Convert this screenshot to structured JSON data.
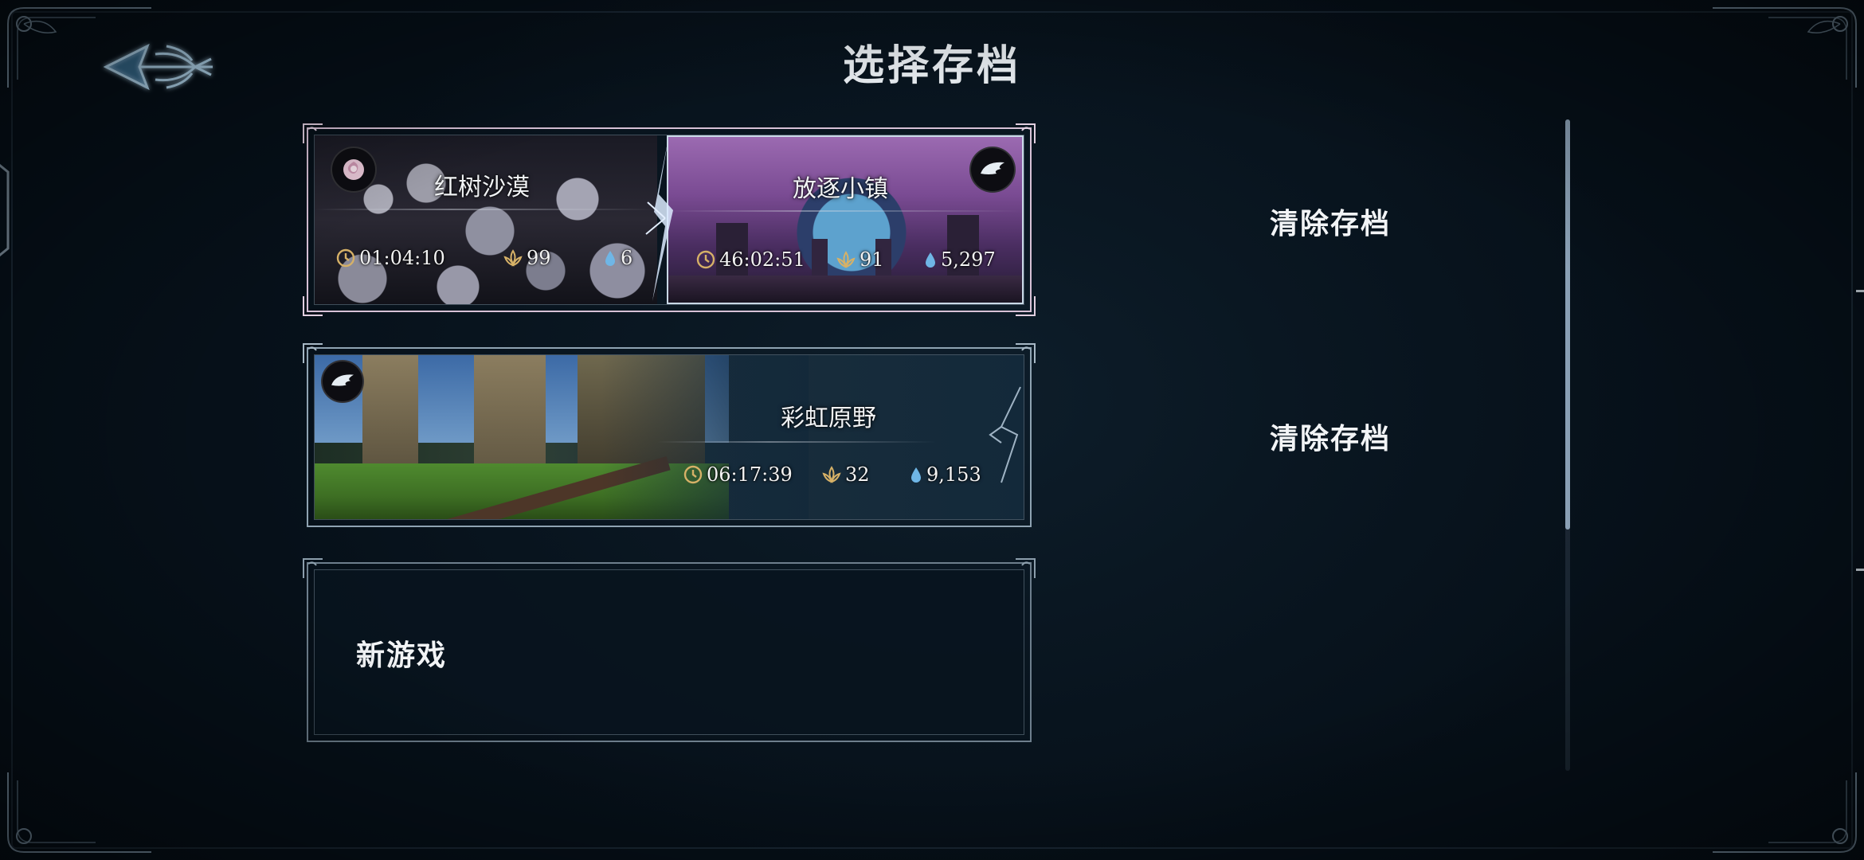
{
  "screen_title": "选择存档",
  "slots": [
    {
      "areas": [
        {
          "name": "红树沙漠",
          "time": "01:04:10",
          "level": "99",
          "souls": "6"
        },
        {
          "name": "放逐小镇",
          "time": "46:02:51",
          "level": "91",
          "souls": "5,297"
        }
      ],
      "clear_label": "清除存档"
    },
    {
      "areas": [
        {
          "name": "彩虹原野",
          "time": "06:17:39",
          "level": "32",
          "souls": "9,153"
        }
      ],
      "clear_label": "清除存档"
    },
    {
      "new_game_label": "新游戏"
    }
  ],
  "icons": {
    "back": "winged-arrow-back-icon",
    "time": "clock-icon",
    "level": "lotus-level-icon",
    "souls": "soul-drop-icon",
    "emblem_rose": "rose-emblem-icon",
    "emblem_wing": "wing-emblem-icon"
  },
  "colors": {
    "accent_blue": "#5fb8f0",
    "gold": "#d6b167",
    "soul_blue": "#6fb6e6",
    "frame_pink": "#d7c1d6",
    "text": "#f1f3f5"
  }
}
